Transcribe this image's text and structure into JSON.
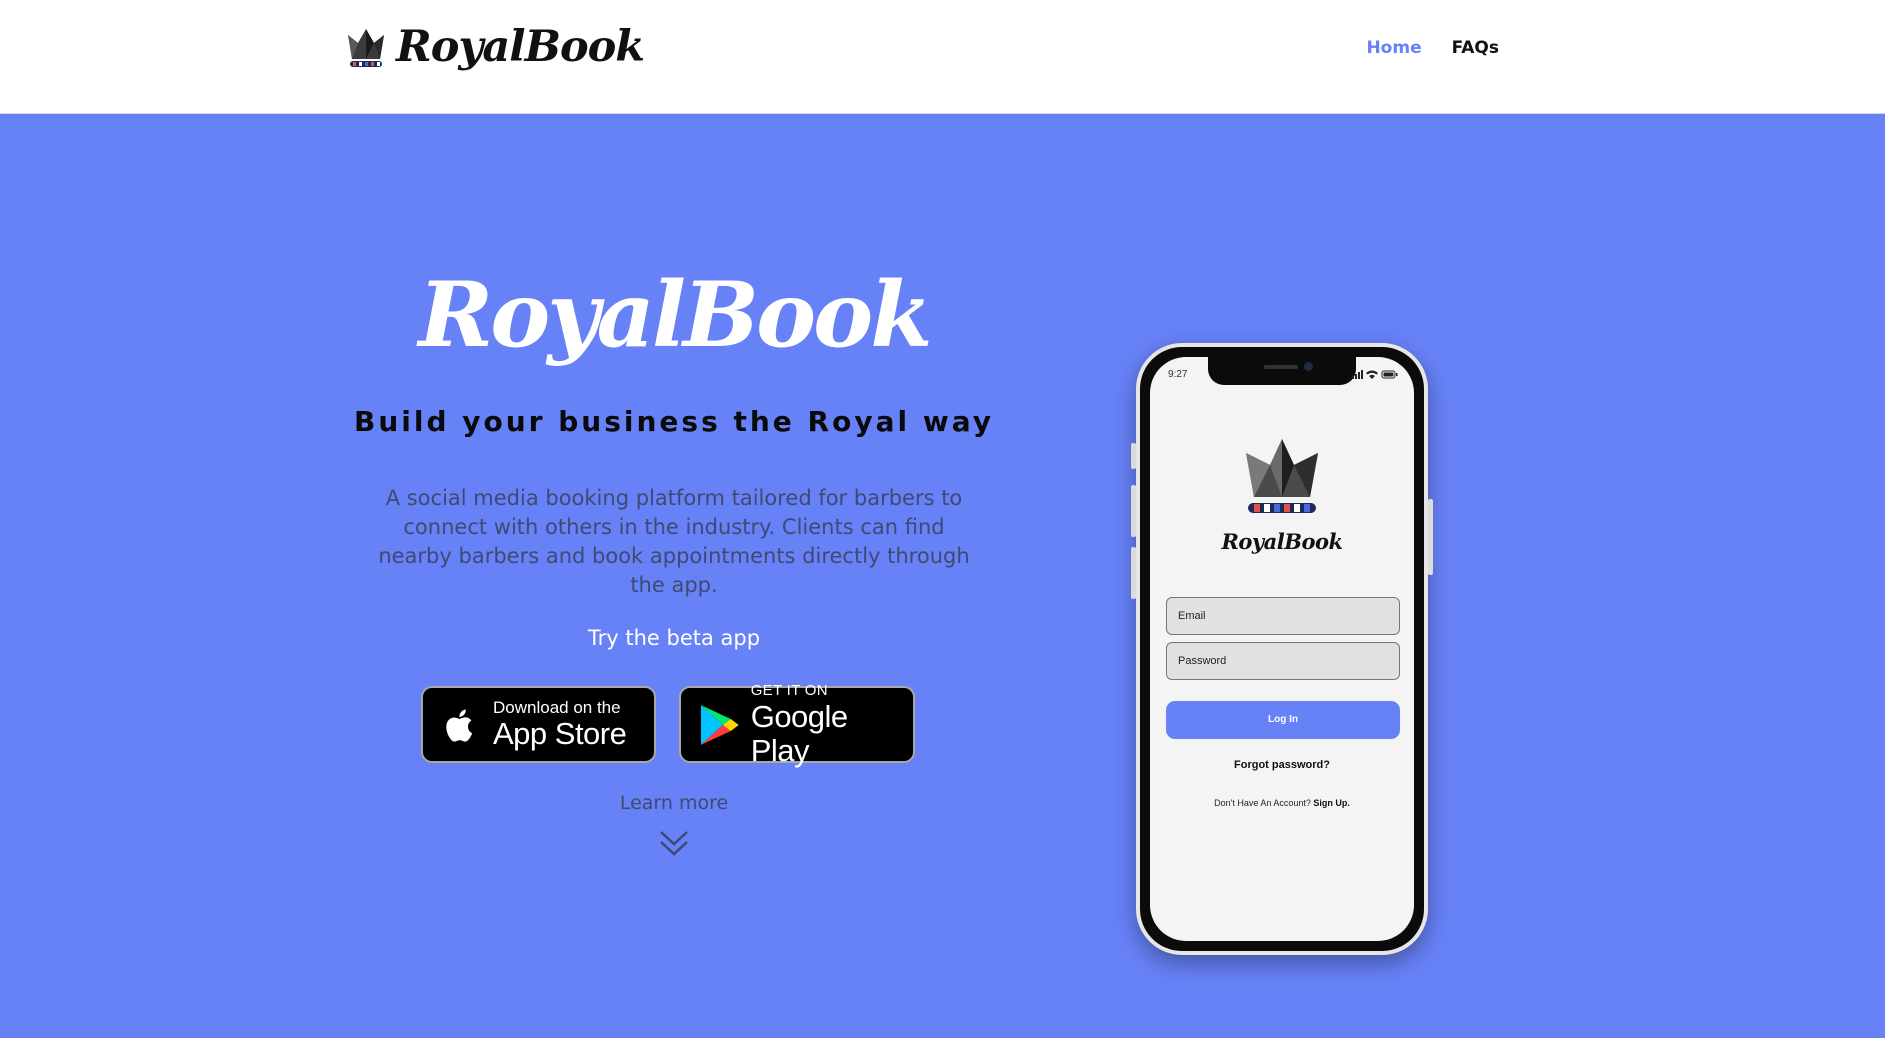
{
  "header": {
    "brand": "RoyalBook",
    "nav": [
      {
        "label": "Home",
        "active": true
      },
      {
        "label": "FAQs",
        "active": false
      }
    ]
  },
  "hero": {
    "title": "RoyalBook",
    "tagline": "Build your business the Royal way",
    "description": "A social media booking platform tailored for barbers to connect with others in the industry. Clients can find nearby barbers and book appointments directly through the app.",
    "beta_label": "Try the beta app",
    "app_store": {
      "small": "Download on the",
      "large": "App Store",
      "icon": "apple-icon"
    },
    "google_play": {
      "small": "GET IT ON",
      "large": "Google Play",
      "icon": "google-play-icon"
    },
    "learn_more": "Learn more"
  },
  "phone": {
    "time": "9:27",
    "app_name": "RoyalBook",
    "email_placeholder": "Email",
    "password_placeholder": "Password",
    "login_label": "Log In",
    "forgot_label": "Forgot password?",
    "no_account_text": "Don't Have An Account?",
    "signup_label": "Sign Up."
  },
  "colors": {
    "accent": "#6781f7",
    "header_bg": "#ffffff",
    "dark_text": "#111111",
    "muted_text": "#3f4a73"
  }
}
